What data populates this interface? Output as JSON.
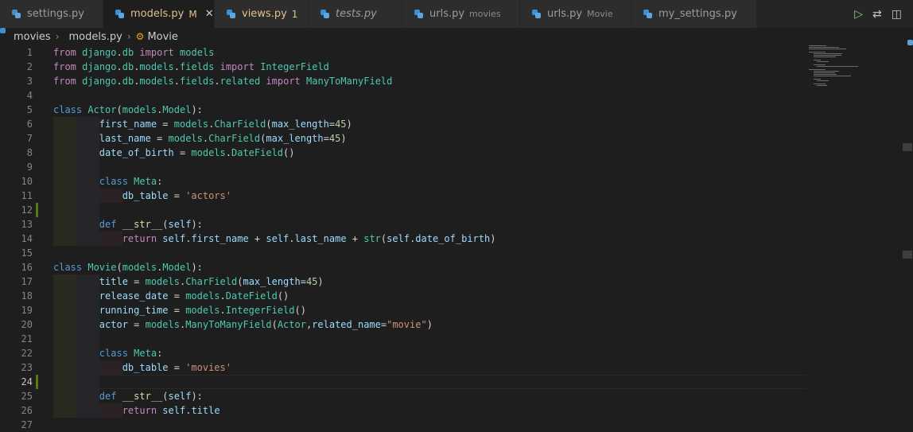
{
  "tabs": [
    {
      "name": "settings.py",
      "desc": "",
      "badge": "",
      "style": "normal"
    },
    {
      "name": "models.py",
      "desc": "",
      "badge": "M",
      "style": "mod",
      "active": true
    },
    {
      "name": "views.py",
      "desc": "",
      "badge": "1",
      "style": "err"
    },
    {
      "name": "tests.py",
      "desc": "",
      "badge": "",
      "style": "italic"
    },
    {
      "name": "urls.py",
      "desc": "movies",
      "badge": "",
      "style": "normal"
    },
    {
      "name": "urls.py",
      "desc": "Movie",
      "badge": "",
      "style": "normal"
    },
    {
      "name": "my_settings.py",
      "desc": "",
      "badge": "",
      "style": "normal"
    }
  ],
  "breadcrumb": {
    "folder": "movies",
    "file": "models.py",
    "symbol": "Movie"
  },
  "editor": {
    "current_line": 24,
    "lines": [
      {
        "n": "1",
        "html": "<span class='kw2'>from</span> <span class='cls'>django</span>.<span class='cls'>db</span> <span class='kw2'>import</span> <span class='cls'>models</span>"
      },
      {
        "n": "2",
        "html": "<span class='kw2'>from</span> <span class='cls'>django</span>.<span class='cls'>db</span>.<span class='cls'>models</span>.<span class='cls'>fields</span> <span class='kw2'>import</span> <span class='cls'>IntegerField</span>"
      },
      {
        "n": "3",
        "html": "<span class='kw2'>from</span> <span class='cls'>django</span>.<span class='cls'>db</span>.<span class='cls'>models</span>.<span class='cls'>fields</span>.<span class='cls'>related</span> <span class='kw2'>import</span> <span class='cls'>ManyToManyField</span>"
      },
      {
        "n": "4",
        "html": ""
      },
      {
        "n": "5",
        "html": "<span class='kw'>class</span> <span class='cls'>Actor</span>(<span class='cls'>models</span>.<span class='cls'>Model</span>):"
      },
      {
        "n": "6",
        "indent": 2,
        "html": "        <span class='var'>first_name</span> = <span class='cls'>models</span>.<span class='cls'>CharField</span>(<span class='var'>max_length</span>=<span class='num'>45</span>)"
      },
      {
        "n": "7",
        "indent": 2,
        "html": "        <span class='var'>last_name</span> = <span class='cls'>models</span>.<span class='cls'>CharField</span>(<span class='var'>max_length</span>=<span class='num'>45</span>)"
      },
      {
        "n": "8",
        "indent": 2,
        "html": "        <span class='var'>date_of_birth</span> = <span class='cls'>models</span>.<span class='cls'>DateField</span>()"
      },
      {
        "n": "9",
        "indent": 2,
        "html": ""
      },
      {
        "n": "10",
        "indent": 2,
        "html": "        <span class='kw'>class</span> <span class='cls'>Meta</span>:"
      },
      {
        "n": "11",
        "indent": 3,
        "html": "            <span class='var'>db_table</span> = <span class='str'>'actors'</span>"
      },
      {
        "n": "12",
        "indent": 2,
        "mark": true,
        "html": ""
      },
      {
        "n": "13",
        "indent": 2,
        "html": "        <span class='kw'>def</span> <span class='fn'>__str__</span>(<span class='self'>self</span>):"
      },
      {
        "n": "14",
        "indent": 3,
        "html": "            <span class='kw2'>return</span> <span class='self'>self</span>.<span class='var'>first_name</span> + <span class='self'>self</span>.<span class='var'>last_name</span> + <span class='cls'>str</span>(<span class='self'>self</span>.<span class='var'>date_of_birth</span>)"
      },
      {
        "n": "15",
        "html": ""
      },
      {
        "n": "16",
        "html": "<span class='kw'>class</span> <span class='cls'>Movie</span>(<span class='cls'>models</span>.<span class='cls'>Model</span>):"
      },
      {
        "n": "17",
        "indent": 2,
        "html": "        <span class='var'>title</span> = <span class='cls'>models</span>.<span class='cls'>CharField</span>(<span class='var'>max_length</span>=<span class='num'>45</span>)"
      },
      {
        "n": "18",
        "indent": 2,
        "html": "        <span class='var'>release_date</span> = <span class='cls'>models</span>.<span class='cls'>DateField</span>()"
      },
      {
        "n": "19",
        "indent": 2,
        "html": "        <span class='var'>running_time</span> = <span class='cls'>models</span>.<span class='cls'>IntegerField</span>()"
      },
      {
        "n": "20",
        "indent": 2,
        "html": "        <span class='var'>actor</span> = <span class='cls'>models</span>.<span class='cls'>ManyToManyField</span>(<span class='cls'>Actor</span>,<span class='var'>related_name</span>=<span class='str'>\"movie\"</span>)"
      },
      {
        "n": "21",
        "indent": 2,
        "html": ""
      },
      {
        "n": "22",
        "indent": 2,
        "html": "        <span class='kw'>class</span> <span class='cls'>Meta</span>:"
      },
      {
        "n": "23",
        "indent": 3,
        "html": "            <span class='var'>db_table</span> = <span class='str'>'movies'</span>"
      },
      {
        "n": "24",
        "indent": 2,
        "mark": true,
        "html": ""
      },
      {
        "n": "25",
        "indent": 2,
        "html": "        <span class='kw'>def</span> <span class='fn'>__str__</span>(<span class='self'>self</span>):"
      },
      {
        "n": "26",
        "indent": 3,
        "html": "            <span class='kw2'>return</span> <span class='self'>self</span>.<span class='var'>title</span>"
      },
      {
        "n": "27",
        "html": ""
      }
    ]
  },
  "colors": {
    "accent": "#569cd6",
    "modified": "#e2c08d",
    "gutter_added": "#587c0c"
  },
  "icons": [
    "python-file-icon",
    "close-icon",
    "run-icon",
    "compare-icon",
    "split-editor-icon",
    "symbol-class-icon",
    "chevron-right-icon"
  ]
}
